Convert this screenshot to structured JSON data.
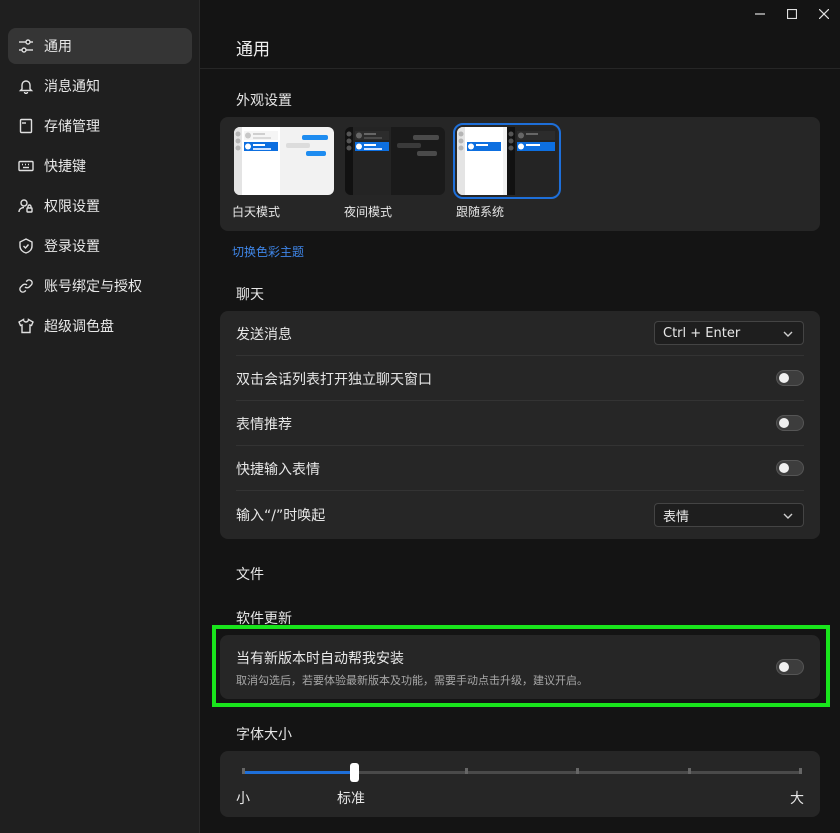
{
  "window": {
    "minimize_icon": "minimize-icon",
    "maximize_icon": "maximize-icon",
    "close_icon": "close-icon"
  },
  "sidebar": {
    "items": [
      {
        "label": "通用",
        "icon": "sliders-icon",
        "active": true
      },
      {
        "label": "消息通知",
        "icon": "bell-icon"
      },
      {
        "label": "存储管理",
        "icon": "storage-icon"
      },
      {
        "label": "快捷键",
        "icon": "keyboard-icon"
      },
      {
        "label": "权限设置",
        "icon": "user-lock-icon"
      },
      {
        "label": "登录设置",
        "icon": "shield-icon"
      },
      {
        "label": "账号绑定与授权",
        "icon": "link-icon"
      },
      {
        "label": "超级调色盘",
        "icon": "shirt-icon"
      }
    ]
  },
  "main": {
    "title": "通用",
    "appearance": {
      "label": "外观设置",
      "themes": [
        {
          "name": "白天模式",
          "selected": false
        },
        {
          "name": "夜间模式",
          "selected": false
        },
        {
          "name": "跟随系统",
          "selected": true
        }
      ],
      "link": "切换色彩主题"
    },
    "chat": {
      "label": "聊天",
      "send_message": {
        "label": "发送消息",
        "value": "Ctrl + Enter"
      },
      "double_click": {
        "label": "双击会话列表打开独立聊天窗口",
        "enabled": false
      },
      "emoji_recommend": {
        "label": "表情推荐",
        "enabled": false
      },
      "quick_emoji": {
        "label": "快捷输入表情",
        "enabled": false
      },
      "slash_trigger": {
        "label": "输入“/”时唤起",
        "value": "表情"
      }
    },
    "files": {
      "label": "文件"
    },
    "update": {
      "label": "软件更新",
      "auto_install": {
        "title": "当有新版本时自动帮我安装",
        "desc": "取消勾选后，若要体验最新版本及功能，需要手动点击升级，建议开启。",
        "enabled": false
      }
    },
    "font_size": {
      "label": "字体大小",
      "min_label": "小",
      "current_label": "标准",
      "max_label": "大",
      "steps": 6,
      "current_step": 1
    }
  },
  "colors": {
    "accent": "#1e6fd9",
    "highlight": "#19e51c",
    "card_bg": "#262626",
    "sidebar_bg": "#1f1f1f"
  }
}
